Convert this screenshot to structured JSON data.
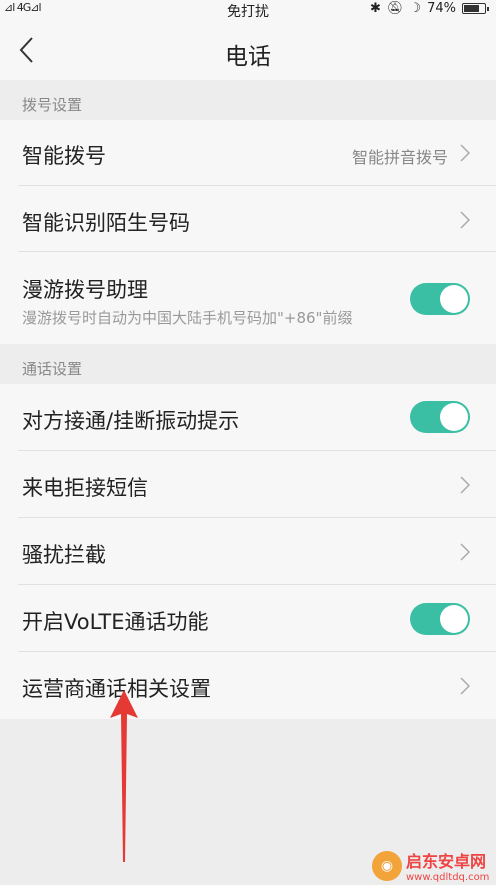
{
  "status": {
    "signal": "⊿l 4G⊿l",
    "mode": "免打扰",
    "battery": "74%",
    "battery_level": 0.74
  },
  "header": {
    "title": "电话"
  },
  "sections": {
    "dial": "拨号设置",
    "call": "通话设置"
  },
  "rows": {
    "smart_dial": {
      "label": "智能拨号",
      "value": "智能拼音拨号"
    },
    "unknown_id": {
      "label": "智能识别陌生号码"
    },
    "roaming": {
      "label": "漫游拨号助理",
      "sub": "漫游拨号时自动为中国大陆手机号码加\"+86\"前缀",
      "on": true
    },
    "vibrate": {
      "label": "对方接通/挂断振动提示",
      "on": true
    },
    "reject_sms": {
      "label": "来电拒接短信"
    },
    "block": {
      "label": "骚扰拦截"
    },
    "volte": {
      "label": "开启VoLTE通话功能",
      "on": true
    },
    "carrier": {
      "label": "运营商通话相关设置"
    }
  },
  "colors": {
    "accent": "#3bbfa4",
    "arrow": "#e53935"
  },
  "watermark": {
    "title": "启东安卓网",
    "url": "www.qdltdq.com"
  }
}
